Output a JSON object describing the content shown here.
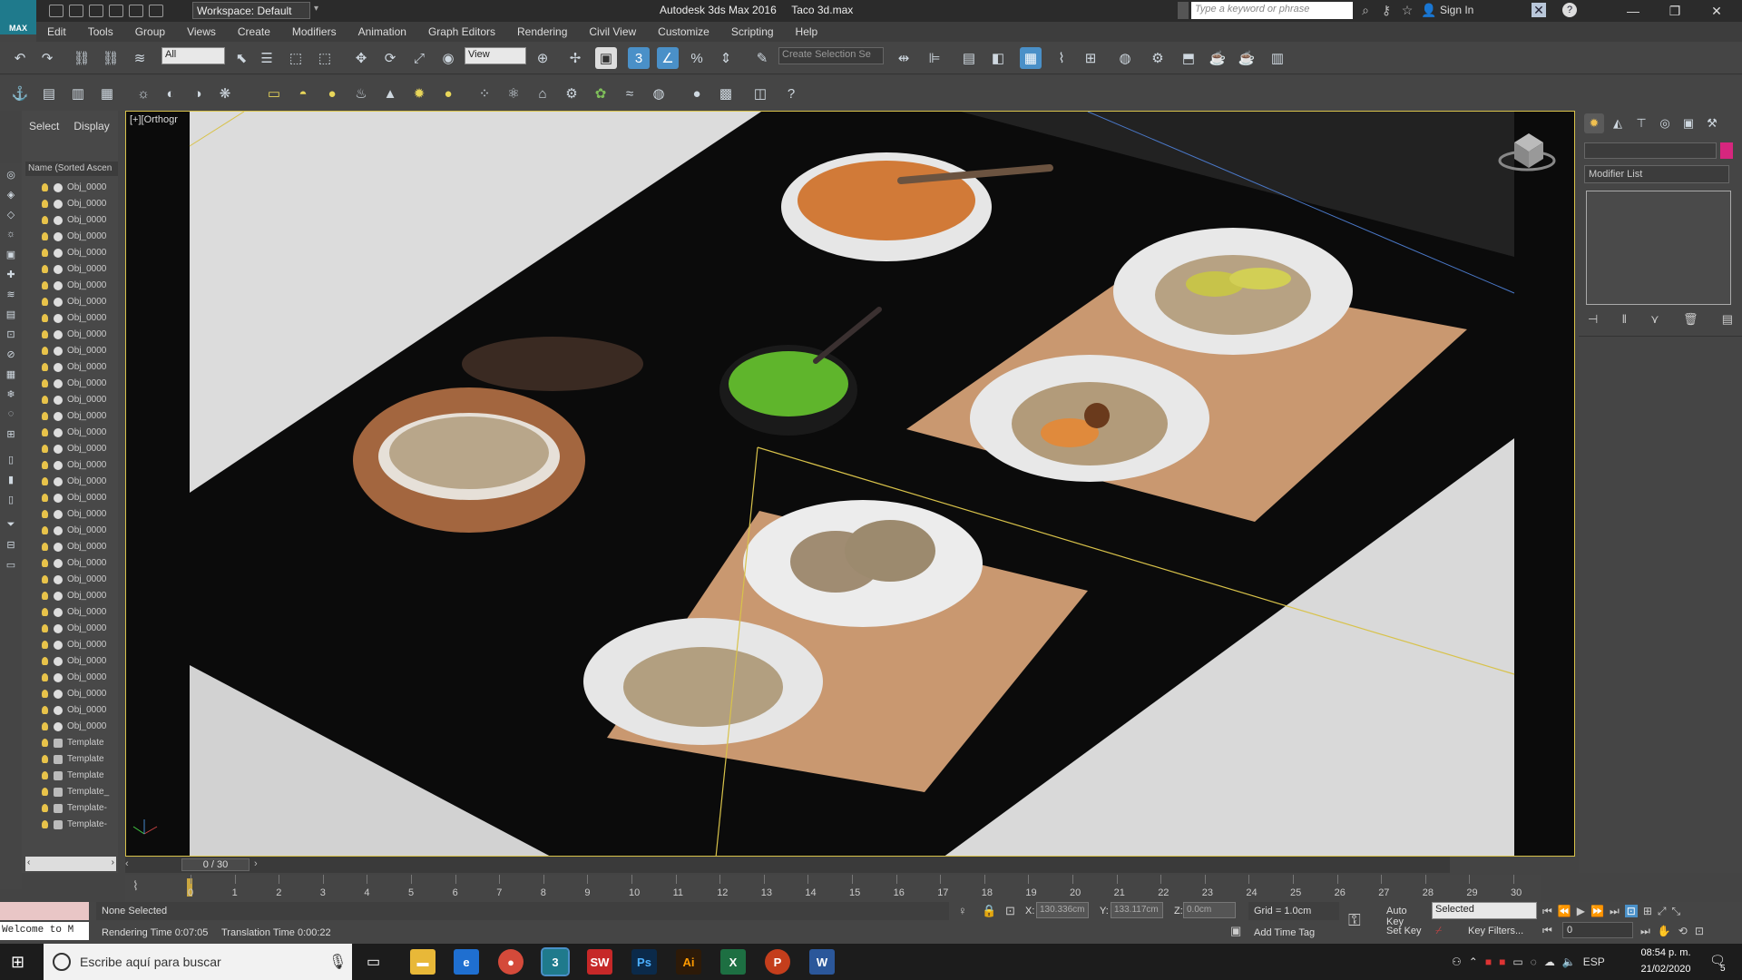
{
  "window": {
    "app_title": "Autodesk 3ds Max 2016",
    "file_name": "Taco 3d.max",
    "logo_text": "MAX",
    "workspace": "Workspace: Default",
    "search_placeholder": "Type a keyword or phrase",
    "sign_in": "Sign In"
  },
  "menu": [
    "Edit",
    "Tools",
    "Group",
    "Views",
    "Create",
    "Modifiers",
    "Animation",
    "Graph Editors",
    "Rendering",
    "Civil View",
    "Customize",
    "Scripting",
    "Help"
  ],
  "toolbar": {
    "selection_filter": "All",
    "reference_coord": "View",
    "named_selection": "Create Selection Se"
  },
  "scene_explorer": {
    "tabs": [
      "Select",
      "Display"
    ],
    "column_header": "Name (Sorted Ascen",
    "rows": [
      {
        "name": "Obj_0000",
        "kind": "object"
      },
      {
        "name": "Obj_0000",
        "kind": "object"
      },
      {
        "name": "Obj_0000",
        "kind": "object"
      },
      {
        "name": "Obj_0000",
        "kind": "object"
      },
      {
        "name": "Obj_0000",
        "kind": "object"
      },
      {
        "name": "Obj_0000",
        "kind": "object"
      },
      {
        "name": "Obj_0000",
        "kind": "object"
      },
      {
        "name": "Obj_0000",
        "kind": "object"
      },
      {
        "name": "Obj_0000",
        "kind": "object"
      },
      {
        "name": "Obj_0000",
        "kind": "object"
      },
      {
        "name": "Obj_0000",
        "kind": "object"
      },
      {
        "name": "Obj_0000",
        "kind": "object"
      },
      {
        "name": "Obj_0000",
        "kind": "object"
      },
      {
        "name": "Obj_0000",
        "kind": "object"
      },
      {
        "name": "Obj_0000",
        "kind": "object"
      },
      {
        "name": "Obj_0000",
        "kind": "object"
      },
      {
        "name": "Obj_0000",
        "kind": "object"
      },
      {
        "name": "Obj_0000",
        "kind": "object"
      },
      {
        "name": "Obj_0000",
        "kind": "object"
      },
      {
        "name": "Obj_0000",
        "kind": "object"
      },
      {
        "name": "Obj_0000",
        "kind": "object"
      },
      {
        "name": "Obj_0000",
        "kind": "object"
      },
      {
        "name": "Obj_0000",
        "kind": "object"
      },
      {
        "name": "Obj_0000",
        "kind": "object"
      },
      {
        "name": "Obj_0000",
        "kind": "object"
      },
      {
        "name": "Obj_0000",
        "kind": "object"
      },
      {
        "name": "Obj_0000",
        "kind": "object"
      },
      {
        "name": "Obj_0000",
        "kind": "object"
      },
      {
        "name": "Obj_0000",
        "kind": "object"
      },
      {
        "name": "Obj_0000",
        "kind": "object"
      },
      {
        "name": "Obj_0000",
        "kind": "object"
      },
      {
        "name": "Obj_0000",
        "kind": "object"
      },
      {
        "name": "Obj_0000",
        "kind": "object"
      },
      {
        "name": "Obj_0000",
        "kind": "object"
      },
      {
        "name": "Template",
        "kind": "template"
      },
      {
        "name": "Template",
        "kind": "template"
      },
      {
        "name": "Template",
        "kind": "template"
      },
      {
        "name": "Template_",
        "kind": "template"
      },
      {
        "name": "Template-",
        "kind": "template"
      },
      {
        "name": "Template-",
        "kind": "template"
      }
    ]
  },
  "viewport": {
    "label": "[+][Orthogr"
  },
  "command_panel": {
    "modifier_list": "Modifier List",
    "name_color": "#d6267e"
  },
  "timeline": {
    "slider": "0 / 30",
    "ticks": [
      "0",
      "1",
      "2",
      "3",
      "4",
      "5",
      "6",
      "7",
      "8",
      "9",
      "10",
      "11",
      "12",
      "13",
      "14",
      "15",
      "16",
      "17",
      "18",
      "19",
      "20",
      "21",
      "22",
      "23",
      "24",
      "25",
      "26",
      "27",
      "28",
      "29",
      "30"
    ]
  },
  "status": {
    "selection": "None Selected",
    "render_time": "Rendering Time 0:07:05",
    "translation_time": "Translation Time 0:00:22",
    "listener": "Welcome to M",
    "x_label": "X:",
    "x_value": "130.336cm",
    "y_label": "Y:",
    "y_value": "133.117cm",
    "z_label": "Z:",
    "z_value": "0.0cm",
    "grid": "Grid = 1.0cm",
    "add_time_tag": "Add Time Tag",
    "auto_key": "Auto Key",
    "set_key": "Set Key",
    "key_mode": "Selected",
    "key_filters": "Key Filters...",
    "frame": "0"
  },
  "taskbar": {
    "search_placeholder": "Escribe aquí para buscar",
    "time": "08:54 p. m.",
    "date": "21/02/2020",
    "notifications": "5"
  }
}
